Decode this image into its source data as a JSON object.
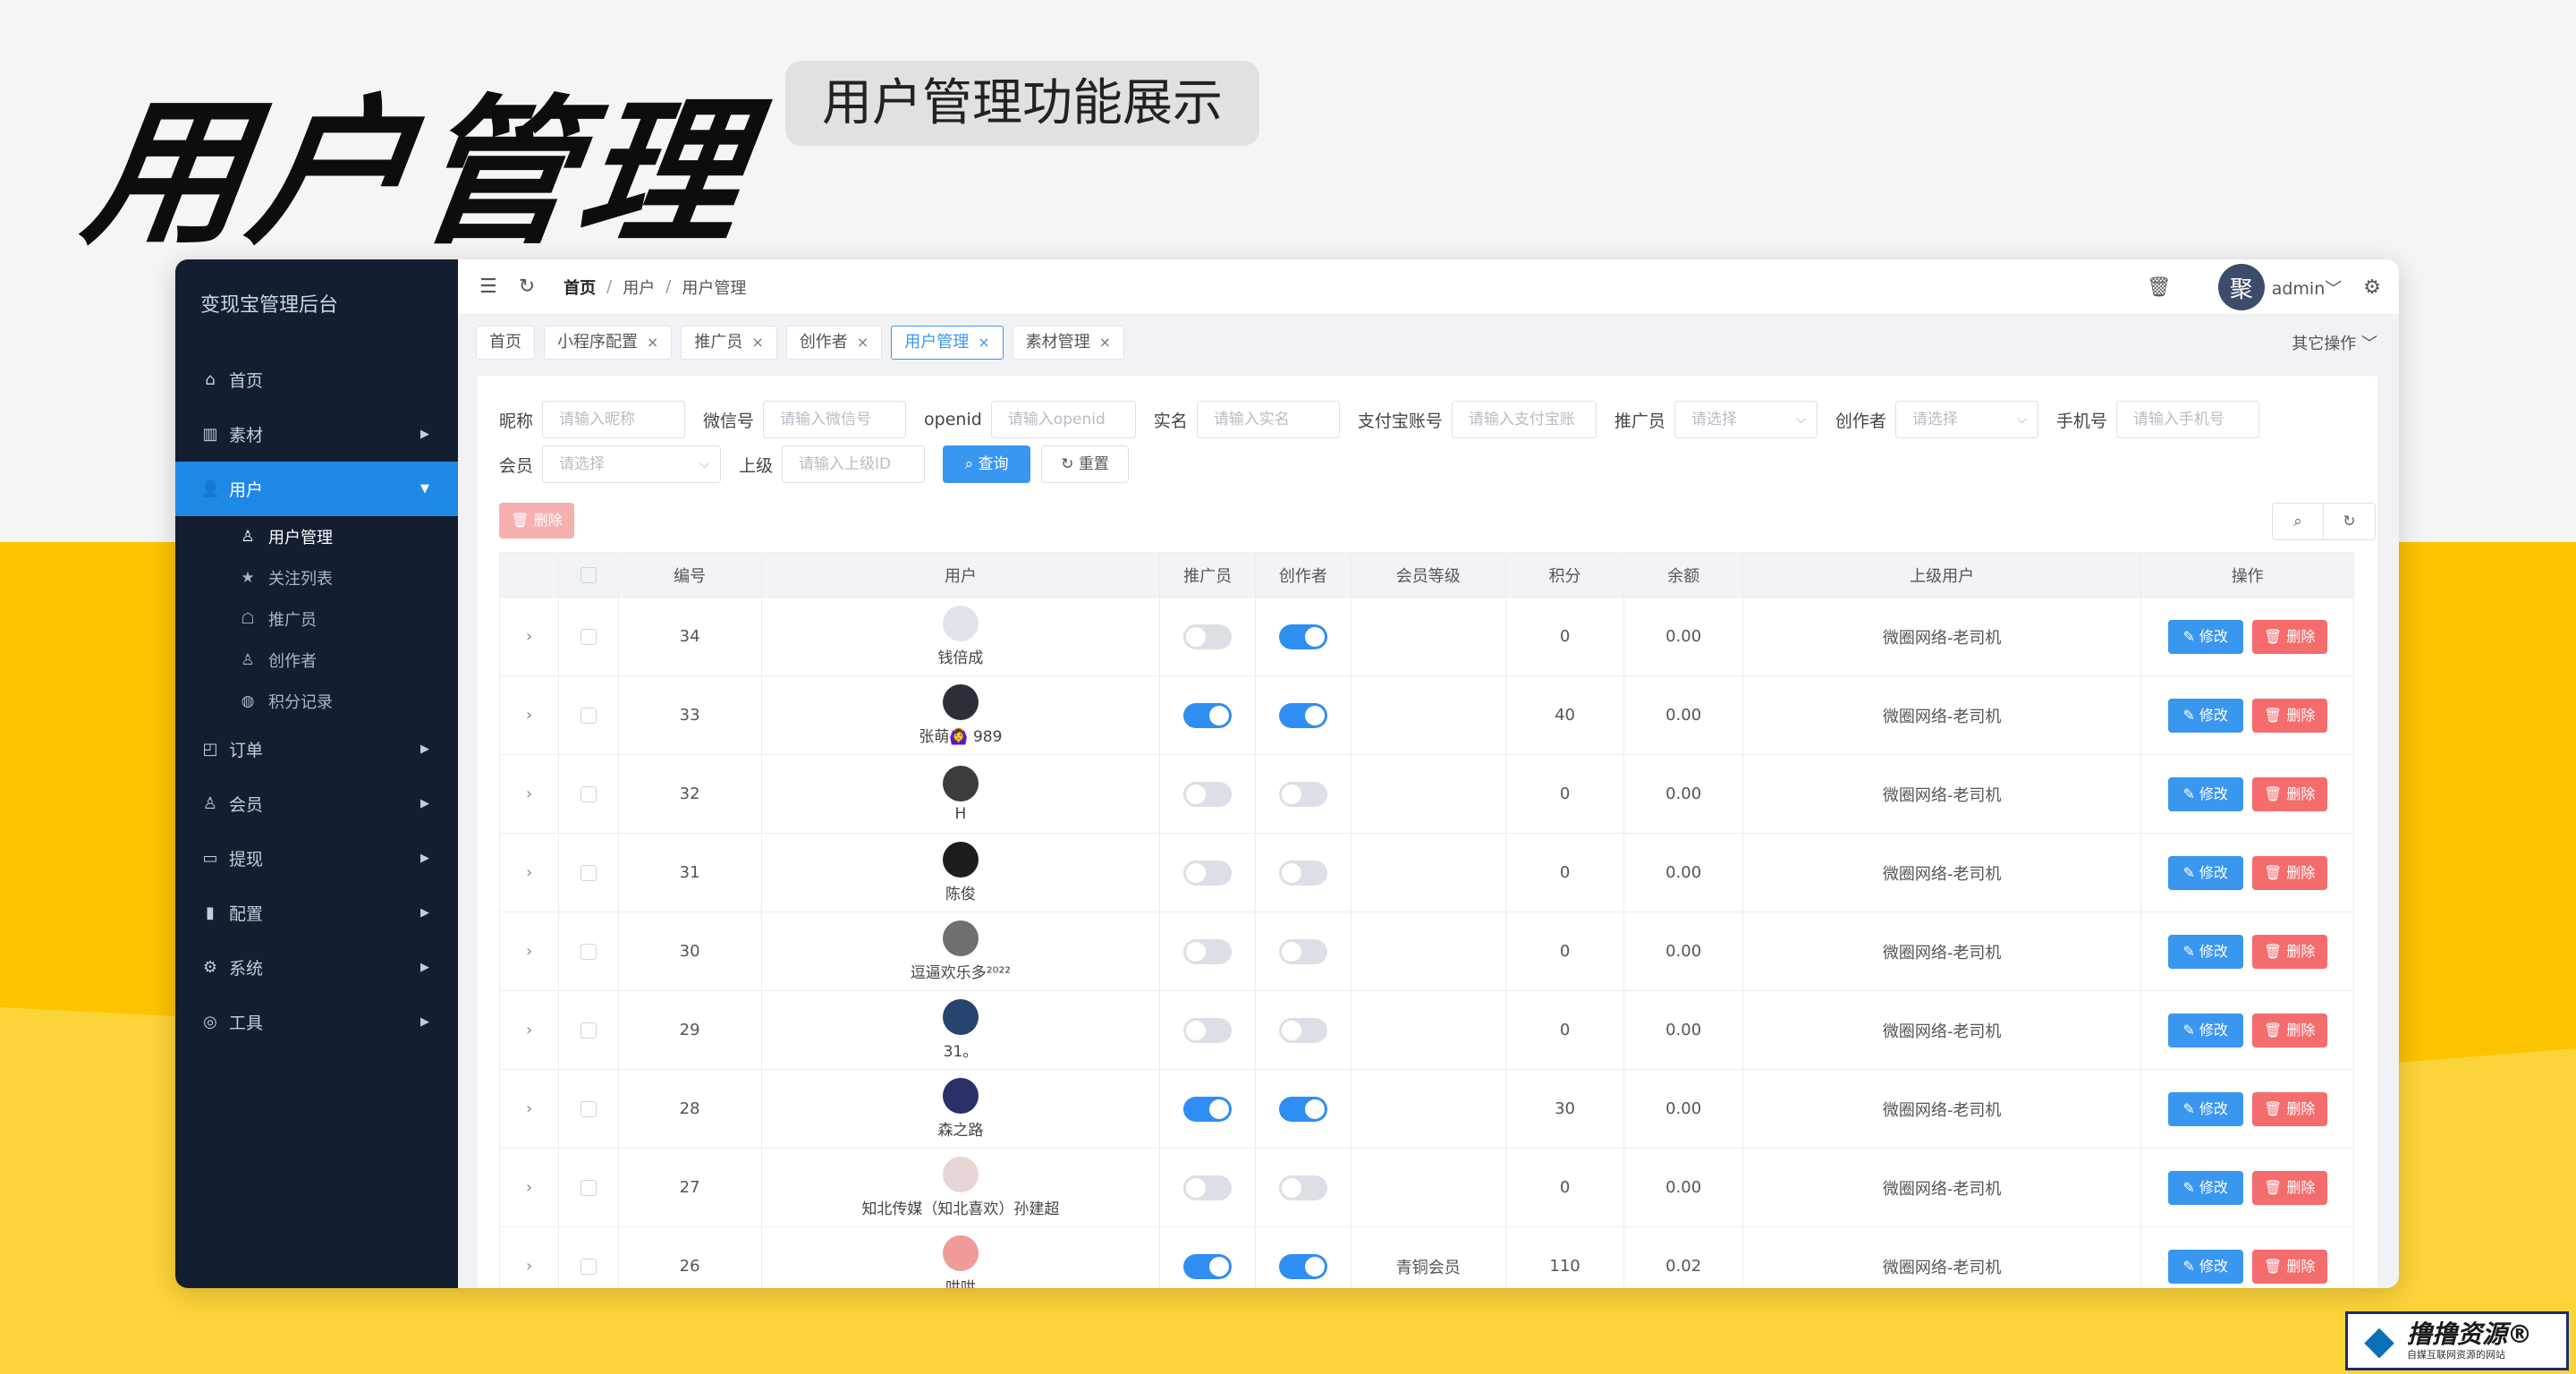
{
  "banner": {
    "title": "用户管理",
    "tag": "用户管理功能展示"
  },
  "sidebar": {
    "title": "变现宝管理后台",
    "items": [
      {
        "icon": "home-icon",
        "glyph": "⌂",
        "label": "首页",
        "arrow": ""
      },
      {
        "icon": "book-icon",
        "glyph": "▥",
        "label": "素材",
        "arrow": "▶"
      },
      {
        "icon": "user-icon",
        "glyph": "👤",
        "label": "用户",
        "arrow": "▼"
      },
      {
        "icon": "bag-icon",
        "glyph": "◰",
        "label": "订单",
        "arrow": "▶"
      },
      {
        "icon": "medal-icon",
        "glyph": "♙",
        "label": "会员",
        "arrow": "▶"
      },
      {
        "icon": "card-icon",
        "glyph": "▭",
        "label": "提现",
        "arrow": "▶"
      },
      {
        "icon": "bar-chart-icon",
        "glyph": "▮",
        "label": "配置",
        "arrow": "▶"
      },
      {
        "icon": "gear-icon",
        "glyph": "⚙",
        "label": "系统",
        "arrow": "▶"
      },
      {
        "icon": "tool-icon",
        "glyph": "◎",
        "label": "工具",
        "arrow": "▶"
      }
    ],
    "sub_items": [
      {
        "icon": "person-outline-icon",
        "glyph": "♙",
        "label": "用户管理"
      },
      {
        "icon": "star-icon",
        "glyph": "★",
        "label": "关注列表"
      },
      {
        "icon": "promoter-icon",
        "glyph": "☖",
        "label": "推广员"
      },
      {
        "icon": "creator-icon",
        "glyph": "♙",
        "label": "创作者"
      },
      {
        "icon": "coins-icon",
        "glyph": "◍",
        "label": "积分记录"
      }
    ]
  },
  "topbar": {
    "breadcrumb": [
      "首页",
      "用户",
      "用户管理"
    ],
    "sep": "/",
    "avatar_text": "聚",
    "user": "admin",
    "caret": "﹀"
  },
  "tabs": {
    "items": [
      {
        "label": "首页",
        "close": ""
      },
      {
        "label": "小程序配置",
        "close": "×"
      },
      {
        "label": "推广员",
        "close": "×"
      },
      {
        "label": "创作者",
        "close": "×"
      },
      {
        "label": "用户管理",
        "close": "×"
      },
      {
        "label": "素材管理",
        "close": "×"
      }
    ],
    "active_index": 4,
    "more": "其它操作 ﹀"
  },
  "filters": {
    "row1": [
      {
        "label": "昵称",
        "placeholder": "请输入昵称",
        "w": 0
      },
      {
        "label": "微信号",
        "placeholder": "请输入微信号"
      },
      {
        "label": "openid",
        "placeholder": "请输入openid"
      },
      {
        "label": "实名",
        "placeholder": "请输入实名"
      },
      {
        "label": "支付宝账号",
        "placeholder": "请输入支付宝账"
      },
      {
        "label": "推广员",
        "placeholder": "请选择",
        "select": true
      },
      {
        "label": "创作者",
        "placeholder": "请选择",
        "select": true
      },
      {
        "label": "手机号",
        "placeholder": "请输入手机号"
      }
    ],
    "row2": [
      {
        "label": "会员",
        "placeholder": "请选择",
        "select": true
      },
      {
        "label": "上级",
        "placeholder": "请输入上级ID"
      }
    ],
    "query_label": "⌕ 查询",
    "reset_label": "↻ 重置"
  },
  "toolbar": {
    "delete_label": "🗑 删除",
    "search_glyph": "⌕",
    "refresh_glyph": "↻"
  },
  "table": {
    "headers": [
      "",
      "",
      "编号",
      "用户",
      "推广员",
      "创作者",
      "会员等级",
      "积分",
      "余额",
      "上级用户",
      "操作"
    ],
    "edit_label": "✎ 修改",
    "delete_label": "🗑 删除",
    "rows": [
      {
        "id": "34",
        "name": "钱倍成",
        "promoter": false,
        "creator": true,
        "level": "",
        "points": "0",
        "balance": "0.00",
        "parent": "微圈网络-老司机",
        "avatar": "#dfe3ea"
      },
      {
        "id": "33",
        "name": "张萌🙆‍♀️        989",
        "promoter": true,
        "creator": true,
        "level": "",
        "points": "40",
        "balance": "0.00",
        "parent": "微圈网络-老司机",
        "avatar": "#2a2f3a"
      },
      {
        "id": "32",
        "name": "H",
        "promoter": false,
        "creator": false,
        "level": "",
        "points": "0",
        "balance": "0.00",
        "parent": "微圈网络-老司机",
        "avatar": "#3c3c3c"
      },
      {
        "id": "31",
        "name": "陈俊",
        "promoter": false,
        "creator": false,
        "level": "",
        "points": "0",
        "balance": "0.00",
        "parent": "微圈网络-老司机",
        "avatar": "#1d1d1d"
      },
      {
        "id": "30",
        "name": "逗逼欢乐多²⁰²²",
        "promoter": false,
        "creator": false,
        "level": "",
        "points": "0",
        "balance": "0.00",
        "parent": "微圈网络-老司机",
        "avatar": "#6f6f6f"
      },
      {
        "id": "29",
        "name": "31。",
        "promoter": false,
        "creator": false,
        "level": "",
        "points": "0",
        "balance": "0.00",
        "parent": "微圈网络-老司机",
        "avatar": "#27446e"
      },
      {
        "id": "28",
        "name": "森之路",
        "promoter": true,
        "creator": true,
        "level": "",
        "points": "30",
        "balance": "0.00",
        "parent": "微圈网络-老司机",
        "avatar": "#2b2f6a"
      },
      {
        "id": "27",
        "name": "知北传媒（知北喜欢）孙建超",
        "promoter": false,
        "creator": false,
        "level": "",
        "points": "0",
        "balance": "0.00",
        "parent": "微圈网络-老司机",
        "avatar": "#e8d6d6"
      },
      {
        "id": "26",
        "name": "哄哄",
        "promoter": true,
        "creator": true,
        "level": "青铜会员",
        "points": "110",
        "balance": "0.02",
        "parent": "微圈网络-老司机",
        "avatar": "#f09a9a"
      }
    ]
  },
  "watermark": {
    "glyph": "◆",
    "main": "撸撸资源®",
    "sub": "自媒互联网资源的网站"
  }
}
